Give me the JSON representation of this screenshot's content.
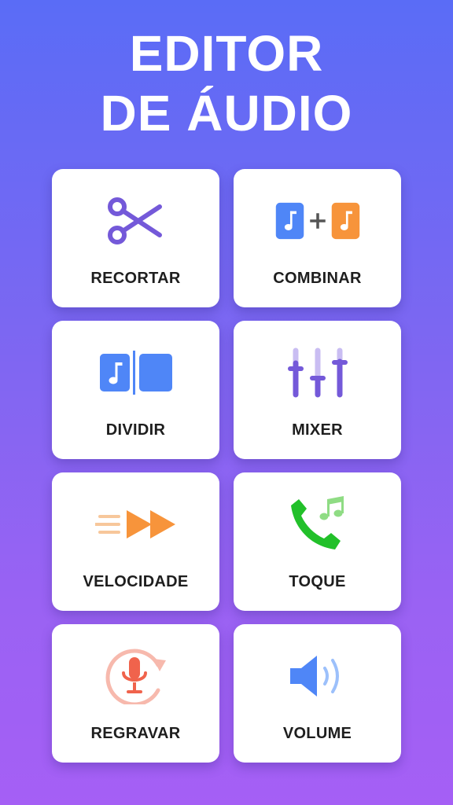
{
  "title": {
    "line1": "EDITOR",
    "line2": "DE ÁUDIO"
  },
  "tools": [
    {
      "label": "RECORTAR",
      "icon": "scissors-icon"
    },
    {
      "label": "COMBINAR",
      "icon": "merge-audio-icon"
    },
    {
      "label": "DIVIDIR",
      "icon": "split-audio-icon"
    },
    {
      "label": "MIXER",
      "icon": "mixer-sliders-icon"
    },
    {
      "label": "VELOCIDADE",
      "icon": "fast-forward-icon"
    },
    {
      "label": "TOQUE",
      "icon": "ringtone-phone-icon"
    },
    {
      "label": "REGRAVAR",
      "icon": "re-record-mic-icon"
    },
    {
      "label": "VOLUME",
      "icon": "speaker-volume-icon"
    }
  ],
  "colors": {
    "purple": "#7459d9",
    "blue": "#4f86f7",
    "orange": "#f7943b",
    "green": "#22c02a",
    "light_green": "#8fdc84",
    "red": "#f0634c",
    "light_blue": "#9cc0fb"
  }
}
